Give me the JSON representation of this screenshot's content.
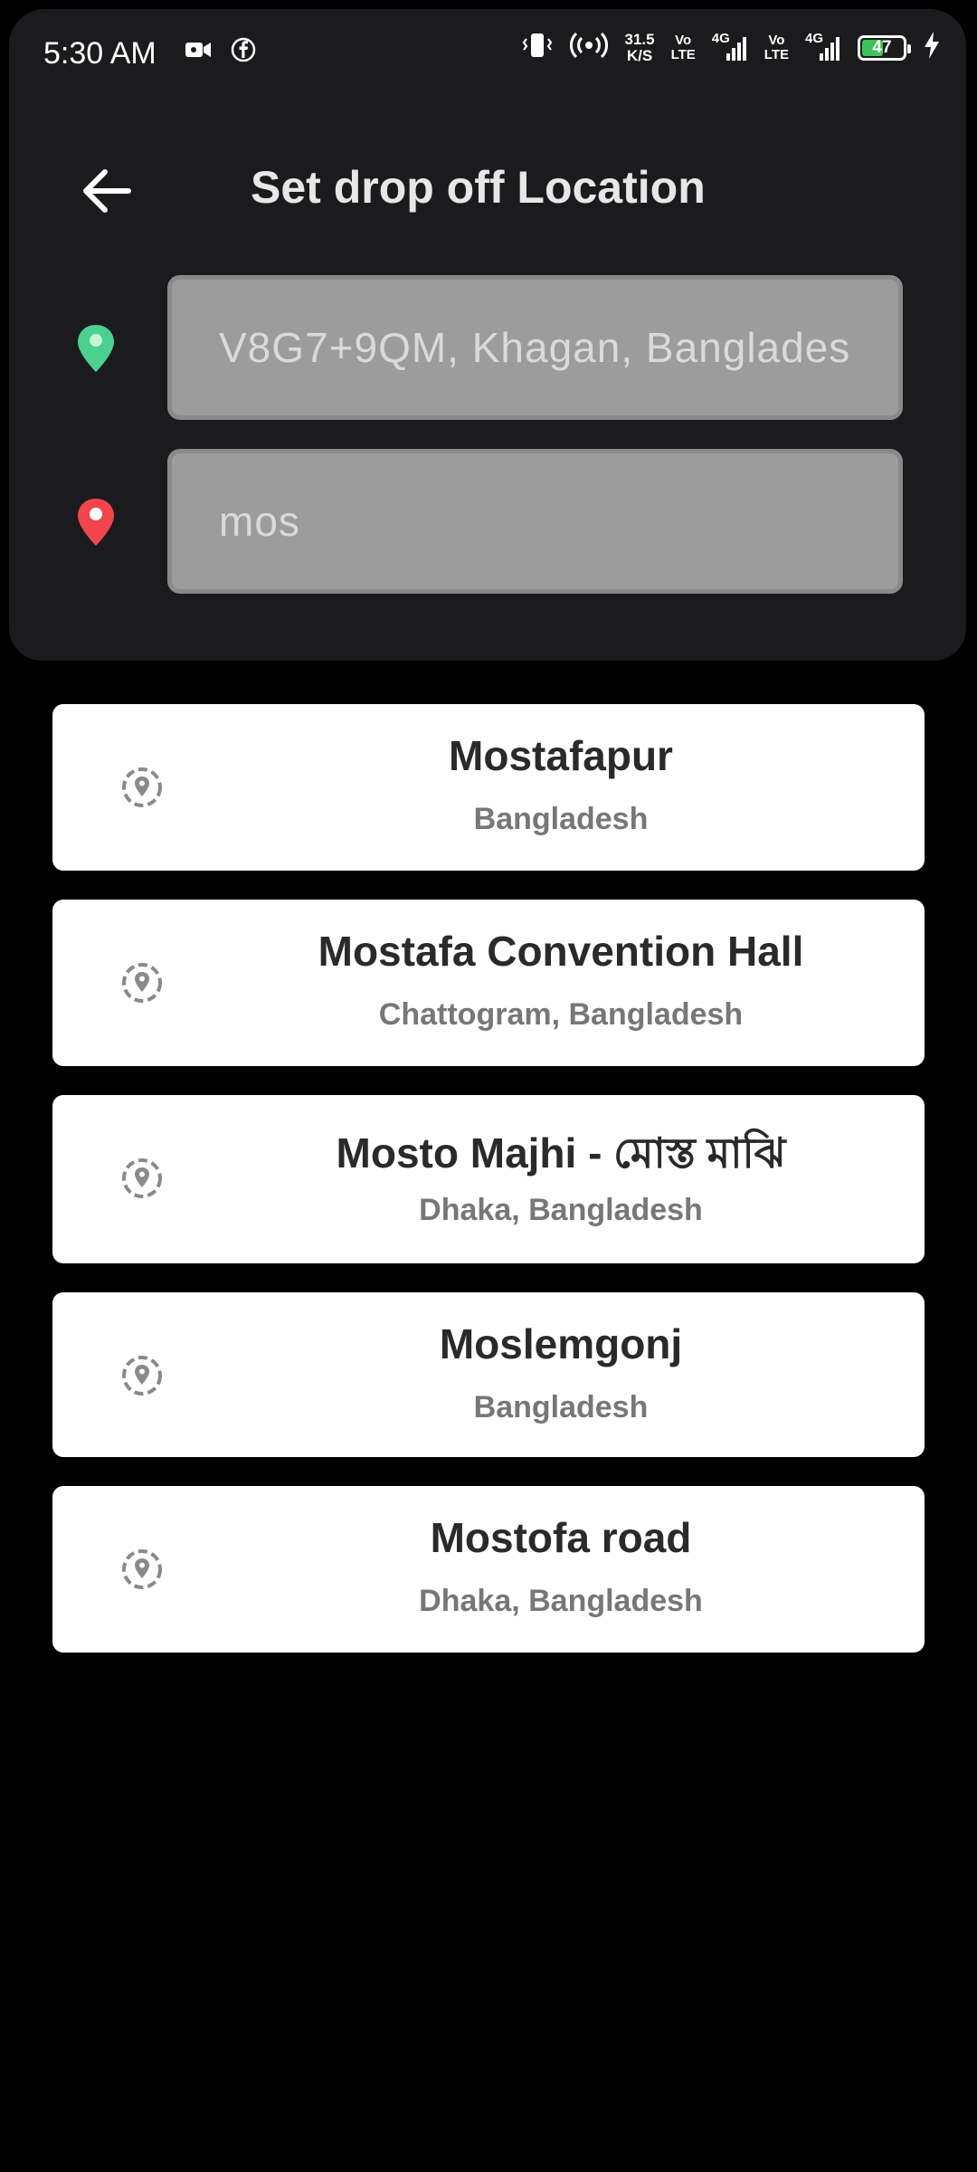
{
  "status_bar": {
    "time": "5:30 AM",
    "speed_value": "31.5",
    "speed_unit": "K/S",
    "net1_top": "Vo",
    "net1_bottom": "LTE",
    "net1_gen": "4G",
    "net2_top": "Vo",
    "net2_bottom": "LTE",
    "net2_gen": "4G",
    "battery": "47"
  },
  "header": {
    "title": "Set drop off Location"
  },
  "pickup": {
    "value": "V8G7+9QM, Khagan, Bangladesh",
    "icon": "green-pin-icon",
    "color": "#4cd08f"
  },
  "dropoff": {
    "value": "mos",
    "icon": "red-pin-icon",
    "color": "#f2454b"
  },
  "results": [
    {
      "title": "Mostafapur",
      "subtitle": "Bangladesh"
    },
    {
      "title": "Mostafa Convention Hall",
      "subtitle": "Chattogram, Bangladesh"
    },
    {
      "title": "Mosto Majhi - মোস্ত মাঝি",
      "subtitle": "Dhaka, Bangladesh"
    },
    {
      "title": "Moslemgonj",
      "subtitle": "Bangladesh"
    },
    {
      "title": "Mostofa road",
      "subtitle": "Dhaka, Bangladesh"
    }
  ],
  "colors": {
    "panel": "#1b1b1d",
    "field": "#9c9c9c",
    "card": "#ffffff"
  }
}
